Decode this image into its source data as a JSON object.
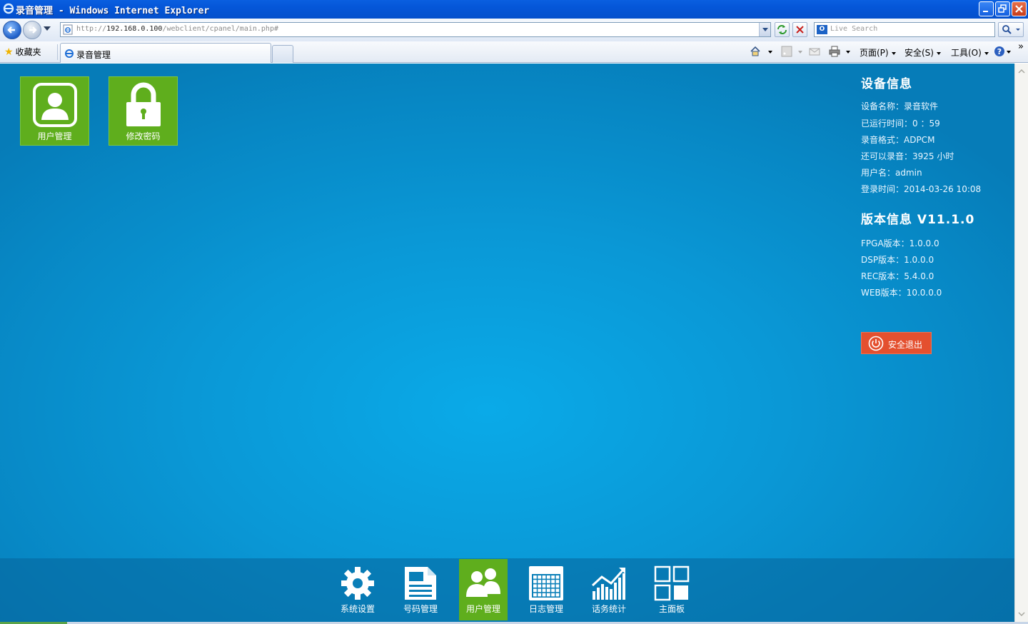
{
  "window": {
    "title": "录音管理 - Windows Internet Explorer",
    "minimize_icon": "minimize-icon",
    "maximize_icon": "restore-icon",
    "close_icon": "close-icon"
  },
  "address_bar": {
    "url_prefix": "http://",
    "url_host": "192.168.0.100",
    "url_path": "/webclient/cpanel/main.php#",
    "search_placeholder": "Live Search"
  },
  "command_bar": {
    "favorites_label": "收藏夹",
    "tab_title": "录音管理",
    "page_menu": "页面(P)",
    "safety_menu": "安全(S)",
    "tools_menu": "工具(O)",
    "chevron": "»"
  },
  "tiles": [
    {
      "label": "用户管理",
      "icon": "user-icon"
    },
    {
      "label": "修改密码",
      "icon": "lock-icon"
    }
  ],
  "device_info": {
    "heading": "设备信息",
    "rows": [
      "设备名称：录音软件",
      "已运行时间：0 ：59",
      "录音格式：ADPCM",
      "还可以录音：3925 小时",
      "用户名：admin",
      "登录时间：2014-03-26 10:08"
    ]
  },
  "version_info": {
    "heading": "版本信息 V11.1.0",
    "rows": [
      "FPGA版本：1.0.0.0",
      "DSP版本：1.0.0.0",
      "REC版本：5.4.0.0",
      "WEB版本：10.0.0.0"
    ]
  },
  "logout_label": "安全退出",
  "dock": [
    {
      "label": "系统设置",
      "icon": "gear-icon",
      "active": false
    },
    {
      "label": "号码管理",
      "icon": "document-icon",
      "active": false
    },
    {
      "label": "用户管理",
      "icon": "users-icon",
      "active": true
    },
    {
      "label": "日志管理",
      "icon": "calendar-icon",
      "active": false
    },
    {
      "label": "话务统计",
      "icon": "chart-icon",
      "active": false
    },
    {
      "label": "主面板",
      "icon": "dashboard-icon",
      "active": false
    }
  ],
  "colors": {
    "accent_green": "#5fae1d",
    "logout_red": "#e4502f",
    "background_blue": "#0a98d6"
  }
}
